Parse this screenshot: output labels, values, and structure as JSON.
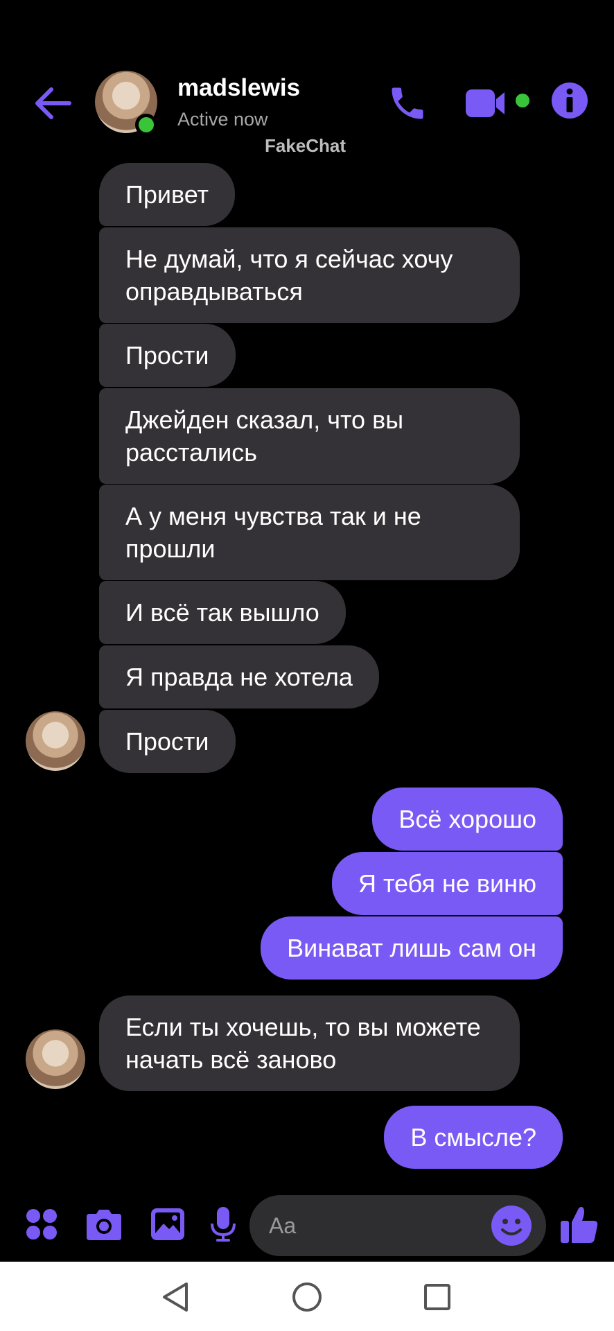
{
  "header": {
    "contact_name": "madslewis",
    "status": "Active now",
    "watermark": "FakeChat"
  },
  "messages": [
    {
      "side": "in",
      "text": "Привет"
    },
    {
      "side": "in",
      "text": "Не думай, что я сейчас хочу оправдываться"
    },
    {
      "side": "in",
      "text": "Прости"
    },
    {
      "side": "in",
      "text": "Джейден сказал, что вы расстались"
    },
    {
      "side": "in",
      "text": "А у меня чувства так и не прошли"
    },
    {
      "side": "in",
      "text": "И всё так вышло"
    },
    {
      "side": "in",
      "text": "Я правда не хотела"
    },
    {
      "side": "in",
      "text": "Прости"
    },
    {
      "side": "out",
      "text": "Всё хорошо"
    },
    {
      "side": "out",
      "text": "Я тебя не виню"
    },
    {
      "side": "out",
      "text": "Винават лишь сам он"
    },
    {
      "side": "in",
      "text": "Если ты хочешь, то вы можете начать всё заново"
    },
    {
      "side": "out",
      "text": "В смысле?"
    }
  ],
  "composer": {
    "placeholder": "Aa"
  },
  "colors": {
    "accent": "#7a5af5",
    "incoming_bubble": "#343236",
    "online": "#3ac43a"
  },
  "icons": {
    "back": "back-arrow-icon",
    "call": "phone-icon",
    "video": "video-camera-icon",
    "info": "info-icon",
    "menu": "four-dots-icon",
    "camera": "camera-icon",
    "gallery": "image-icon",
    "mic": "microphone-icon",
    "emoji": "smiley-icon",
    "like": "thumbs-up-icon"
  }
}
